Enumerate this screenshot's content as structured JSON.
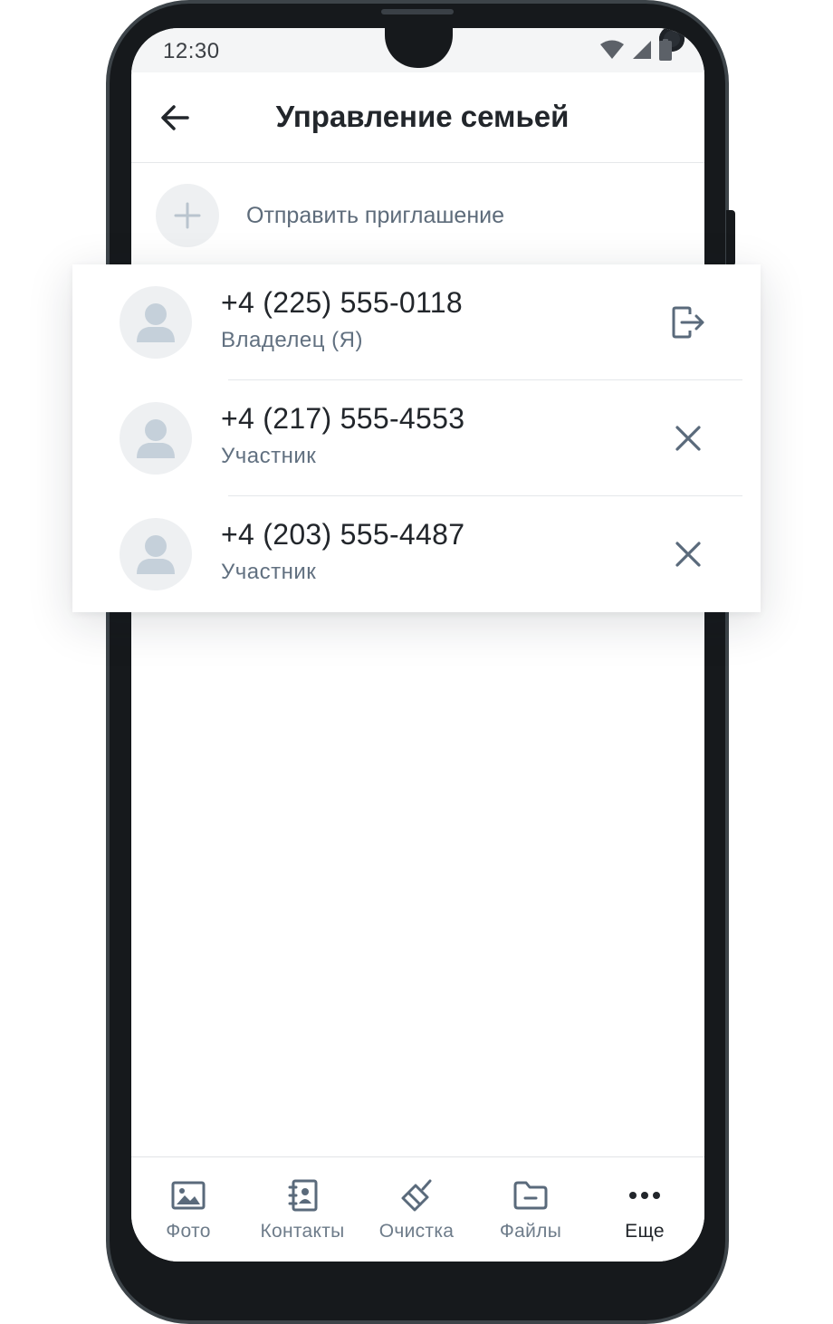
{
  "status_bar": {
    "time": "12:30",
    "icons": [
      "wifi-icon",
      "cell-signal-icon",
      "battery-icon"
    ]
  },
  "header": {
    "title": "Управление семьей",
    "back_icon": "arrow-left-icon"
  },
  "invite": {
    "label": "Отправить приглашение",
    "icon": "plus-icon"
  },
  "members": [
    {
      "phone": "+4 (225) 555-0118",
      "role": "Владелец (Я)",
      "action_icon": "leave-icon"
    },
    {
      "phone": "+4 (217) 555-4553",
      "role": "Участник",
      "action_icon": "close-icon"
    },
    {
      "phone": "+4 (203) 555-4487",
      "role": "Участник",
      "action_icon": "close-icon"
    }
  ],
  "bottom_nav": {
    "items": [
      {
        "label": "Фото",
        "icon": "image-icon",
        "active": false
      },
      {
        "label": "Контакты",
        "icon": "contacts-icon",
        "active": false
      },
      {
        "label": "Очистка",
        "icon": "broom-icon",
        "active": false
      },
      {
        "label": "Файлы",
        "icon": "folder-icon",
        "active": false
      },
      {
        "label": "Еще",
        "icon": "more-icon",
        "active": true
      }
    ]
  },
  "colors": {
    "text_primary": "#22262b",
    "text_secondary": "#617080",
    "icon_gray": "#5a6a7b",
    "avatar_bg": "#eef0f2",
    "avatar_figure": "#c5d0da",
    "phone_frame": "#16191c"
  }
}
